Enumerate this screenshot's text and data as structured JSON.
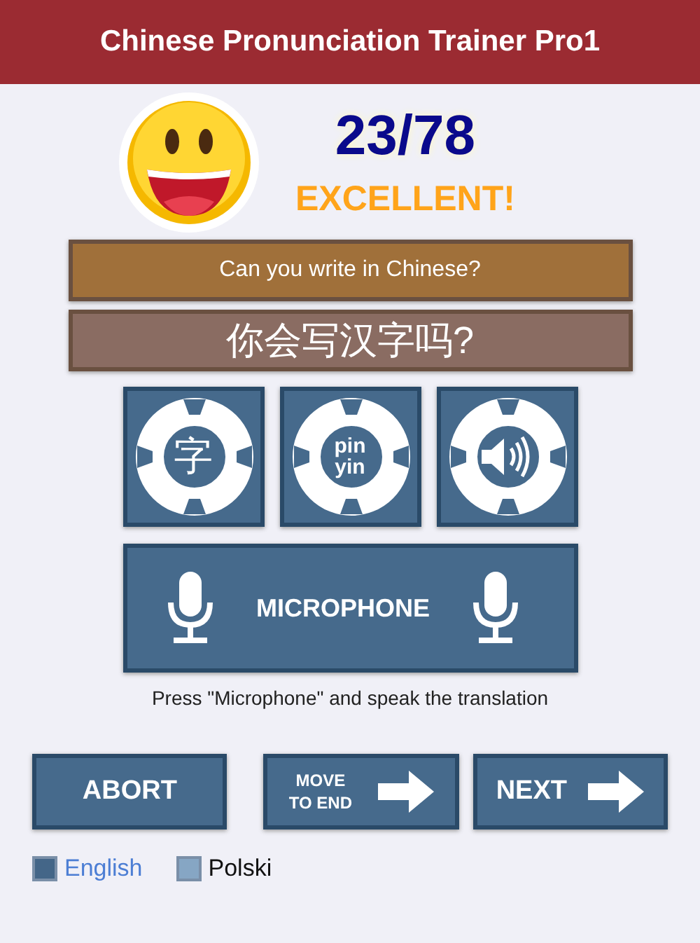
{
  "header": {
    "title": "Chinese Pronunciation Trainer Pro1"
  },
  "score": {
    "value": "23/78",
    "rating": "EXCELLENT!"
  },
  "question": {
    "text": "Can you write in Chinese?"
  },
  "answer": {
    "text": "你会写汉字吗?"
  },
  "hint_buttons": [
    {
      "kind": "glyph",
      "text": "字"
    },
    {
      "kind": "pinyin",
      "lines": [
        "pin",
        "yin"
      ]
    },
    {
      "kind": "audio"
    }
  ],
  "microphone": {
    "label": "MICROPHONE"
  },
  "instruction": "Press \"Microphone\" and speak the translation",
  "actions": [
    {
      "kind": "plain",
      "label": "ABORT"
    },
    {
      "kind": "arrow",
      "lines": [
        "MOVE",
        "TO END"
      ]
    },
    {
      "kind": "arrow",
      "lines": [
        "NEXT"
      ]
    }
  ],
  "languages": [
    {
      "label": "English",
      "selected": true
    },
    {
      "label": "Polski",
      "selected": false
    }
  ]
}
